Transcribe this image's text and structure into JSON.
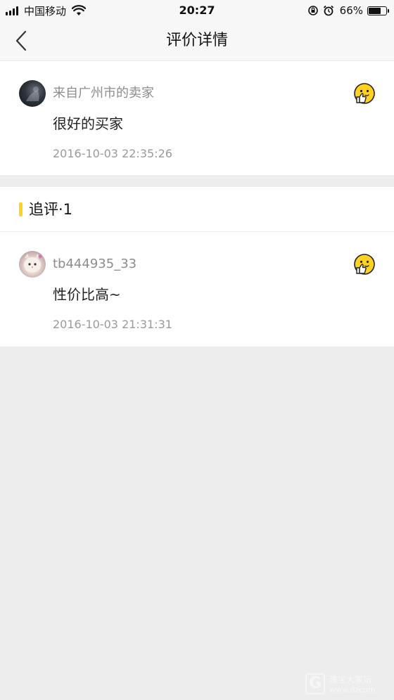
{
  "status_bar": {
    "carrier": "中国移动",
    "time": "20:27",
    "battery_percent": "66%",
    "battery_level": 0.66,
    "icons": [
      "signal-icon",
      "wifi-icon",
      "orientation-lock-icon",
      "alarm-icon",
      "battery-icon"
    ]
  },
  "nav": {
    "title": "评价详情",
    "back_icon": "chevron-left-icon"
  },
  "review": {
    "reviewer": "来自广州市的卖家",
    "text": "很好的买家",
    "time": "2016-10-03 22:35:26",
    "emoji_icon": "thumbs-up-emoji-icon"
  },
  "followup": {
    "title": "追评·1",
    "accent_color": "#ffd21f"
  },
  "followup_review": {
    "reviewer": "tb444935_33",
    "text": "性价比高~",
    "time": "2016-10-03 21:31:31",
    "emoji_icon": "thumbs-up-emoji-icon"
  },
  "watermark": {
    "letter": "G",
    "text": "珠宝大家坛",
    "url": "www.dzcom"
  }
}
